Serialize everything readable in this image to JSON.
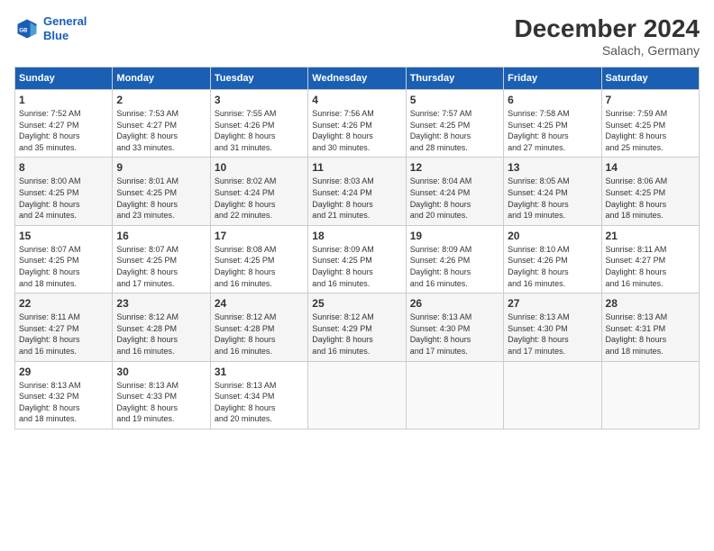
{
  "logo": {
    "line1": "General",
    "line2": "Blue"
  },
  "header": {
    "title": "December 2024",
    "location": "Salach, Germany"
  },
  "weekdays": [
    "Sunday",
    "Monday",
    "Tuesday",
    "Wednesday",
    "Thursday",
    "Friday",
    "Saturday"
  ],
  "weeks": [
    [
      {
        "day": "1",
        "info": "Sunrise: 7:52 AM\nSunset: 4:27 PM\nDaylight: 8 hours\nand 35 minutes."
      },
      {
        "day": "2",
        "info": "Sunrise: 7:53 AM\nSunset: 4:27 PM\nDaylight: 8 hours\nand 33 minutes."
      },
      {
        "day": "3",
        "info": "Sunrise: 7:55 AM\nSunset: 4:26 PM\nDaylight: 8 hours\nand 31 minutes."
      },
      {
        "day": "4",
        "info": "Sunrise: 7:56 AM\nSunset: 4:26 PM\nDaylight: 8 hours\nand 30 minutes."
      },
      {
        "day": "5",
        "info": "Sunrise: 7:57 AM\nSunset: 4:25 PM\nDaylight: 8 hours\nand 28 minutes."
      },
      {
        "day": "6",
        "info": "Sunrise: 7:58 AM\nSunset: 4:25 PM\nDaylight: 8 hours\nand 27 minutes."
      },
      {
        "day": "7",
        "info": "Sunrise: 7:59 AM\nSunset: 4:25 PM\nDaylight: 8 hours\nand 25 minutes."
      }
    ],
    [
      {
        "day": "8",
        "info": "Sunrise: 8:00 AM\nSunset: 4:25 PM\nDaylight: 8 hours\nand 24 minutes."
      },
      {
        "day": "9",
        "info": "Sunrise: 8:01 AM\nSunset: 4:25 PM\nDaylight: 8 hours\nand 23 minutes."
      },
      {
        "day": "10",
        "info": "Sunrise: 8:02 AM\nSunset: 4:24 PM\nDaylight: 8 hours\nand 22 minutes."
      },
      {
        "day": "11",
        "info": "Sunrise: 8:03 AM\nSunset: 4:24 PM\nDaylight: 8 hours\nand 21 minutes."
      },
      {
        "day": "12",
        "info": "Sunrise: 8:04 AM\nSunset: 4:24 PM\nDaylight: 8 hours\nand 20 minutes."
      },
      {
        "day": "13",
        "info": "Sunrise: 8:05 AM\nSunset: 4:24 PM\nDaylight: 8 hours\nand 19 minutes."
      },
      {
        "day": "14",
        "info": "Sunrise: 8:06 AM\nSunset: 4:25 PM\nDaylight: 8 hours\nand 18 minutes."
      }
    ],
    [
      {
        "day": "15",
        "info": "Sunrise: 8:07 AM\nSunset: 4:25 PM\nDaylight: 8 hours\nand 18 minutes."
      },
      {
        "day": "16",
        "info": "Sunrise: 8:07 AM\nSunset: 4:25 PM\nDaylight: 8 hours\nand 17 minutes."
      },
      {
        "day": "17",
        "info": "Sunrise: 8:08 AM\nSunset: 4:25 PM\nDaylight: 8 hours\nand 16 minutes."
      },
      {
        "day": "18",
        "info": "Sunrise: 8:09 AM\nSunset: 4:25 PM\nDaylight: 8 hours\nand 16 minutes."
      },
      {
        "day": "19",
        "info": "Sunrise: 8:09 AM\nSunset: 4:26 PM\nDaylight: 8 hours\nand 16 minutes."
      },
      {
        "day": "20",
        "info": "Sunrise: 8:10 AM\nSunset: 4:26 PM\nDaylight: 8 hours\nand 16 minutes."
      },
      {
        "day": "21",
        "info": "Sunrise: 8:11 AM\nSunset: 4:27 PM\nDaylight: 8 hours\nand 16 minutes."
      }
    ],
    [
      {
        "day": "22",
        "info": "Sunrise: 8:11 AM\nSunset: 4:27 PM\nDaylight: 8 hours\nand 16 minutes."
      },
      {
        "day": "23",
        "info": "Sunrise: 8:12 AM\nSunset: 4:28 PM\nDaylight: 8 hours\nand 16 minutes."
      },
      {
        "day": "24",
        "info": "Sunrise: 8:12 AM\nSunset: 4:28 PM\nDaylight: 8 hours\nand 16 minutes."
      },
      {
        "day": "25",
        "info": "Sunrise: 8:12 AM\nSunset: 4:29 PM\nDaylight: 8 hours\nand 16 minutes."
      },
      {
        "day": "26",
        "info": "Sunrise: 8:13 AM\nSunset: 4:30 PM\nDaylight: 8 hours\nand 17 minutes."
      },
      {
        "day": "27",
        "info": "Sunrise: 8:13 AM\nSunset: 4:30 PM\nDaylight: 8 hours\nand 17 minutes."
      },
      {
        "day": "28",
        "info": "Sunrise: 8:13 AM\nSunset: 4:31 PM\nDaylight: 8 hours\nand 18 minutes."
      }
    ],
    [
      {
        "day": "29",
        "info": "Sunrise: 8:13 AM\nSunset: 4:32 PM\nDaylight: 8 hours\nand 18 minutes."
      },
      {
        "day": "30",
        "info": "Sunrise: 8:13 AM\nSunset: 4:33 PM\nDaylight: 8 hours\nand 19 minutes."
      },
      {
        "day": "31",
        "info": "Sunrise: 8:13 AM\nSunset: 4:34 PM\nDaylight: 8 hours\nand 20 minutes."
      },
      {
        "day": "",
        "info": ""
      },
      {
        "day": "",
        "info": ""
      },
      {
        "day": "",
        "info": ""
      },
      {
        "day": "",
        "info": ""
      }
    ]
  ]
}
